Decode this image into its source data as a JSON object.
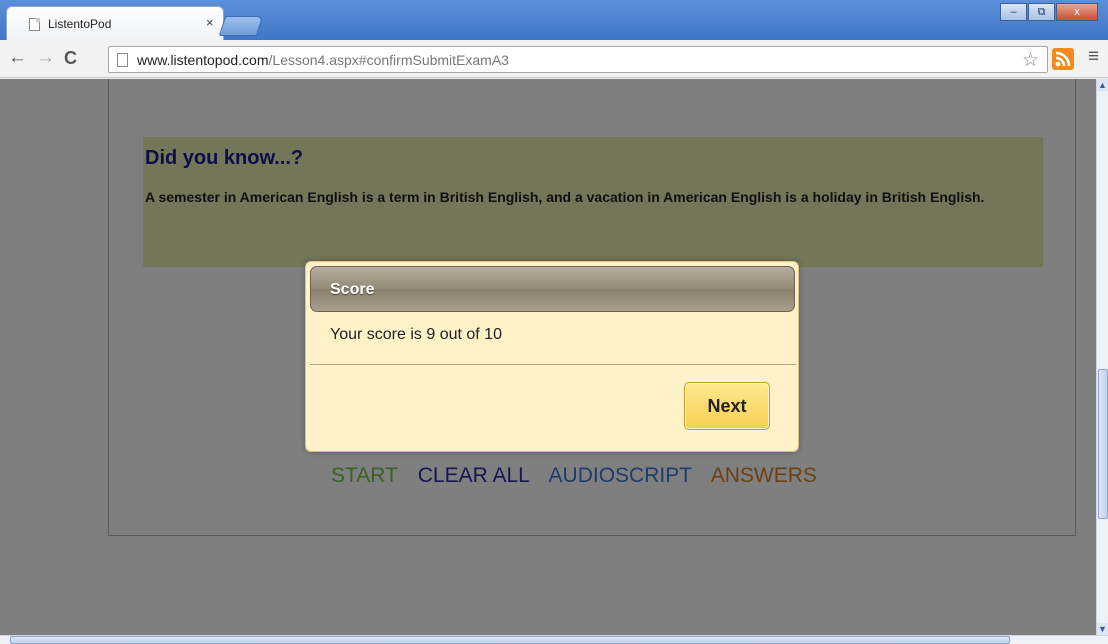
{
  "browser": {
    "tab_title": "ListentoPod",
    "tab_close": "×",
    "window_buttons": {
      "minimize": "–",
      "maximize": "⧉",
      "close": "x"
    },
    "nav": {
      "back": "←",
      "forward": "→",
      "reload": "C"
    },
    "url_domain": "www.listentopod.com",
    "url_path": "/Lesson4.aspx#confirmSubmitExamA3",
    "star": "☆",
    "menu": "≡"
  },
  "page": {
    "did_you_know_title": "Did you know...?",
    "did_you_know_text": "A semester in American English is a term in British English, and a vacation in American English is a holiday in British English.",
    "links": {
      "start": "START",
      "clear_all": "CLEAR ALL",
      "audioscript": "AUDIOSCRIPT",
      "answers": "ANSWERS"
    },
    "colors": {
      "start": "#74c04b",
      "clear_all": "#2c2ca8",
      "audioscript": "#3a78d6",
      "answers": "#d98020"
    }
  },
  "dialog": {
    "title": "Score",
    "message": "Your score is 9 out of 10",
    "next_label": "Next"
  },
  "icons": [
    "page-icon",
    "close-icon",
    "back-icon",
    "forward-icon",
    "reload-icon",
    "star-icon",
    "rss-icon",
    "menu-icon"
  ]
}
